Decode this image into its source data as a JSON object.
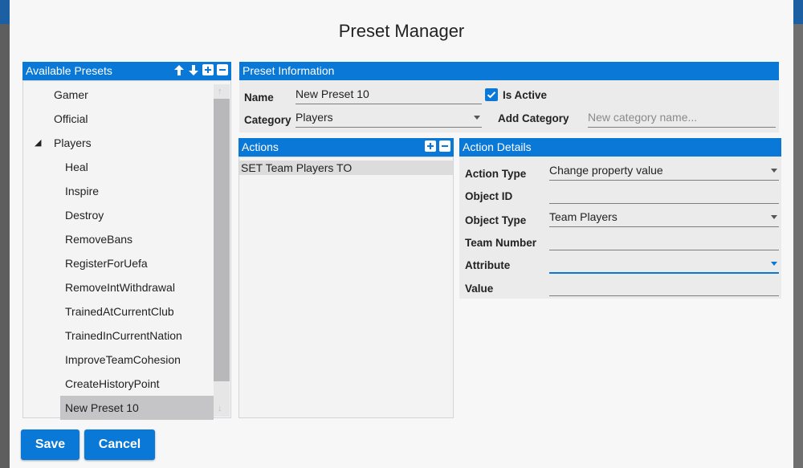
{
  "dialog": {
    "title": "Preset Manager"
  },
  "presets_panel": {
    "title": "Available Presets",
    "items": [
      {
        "label": "Gamer",
        "level": 0
      },
      {
        "label": "Official",
        "level": 0
      },
      {
        "label": "Players",
        "level": 0,
        "expanded": true
      },
      {
        "label": "Heal",
        "level": 1
      },
      {
        "label": "Inspire",
        "level": 1
      },
      {
        "label": "Destroy",
        "level": 1
      },
      {
        "label": "RemoveBans",
        "level": 1
      },
      {
        "label": "RegisterForUefa",
        "level": 1
      },
      {
        "label": "RemoveIntWithdrawal",
        "level": 1
      },
      {
        "label": "TrainedAtCurrentClub",
        "level": 1
      },
      {
        "label": "TrainedInCurrentNation",
        "level": 1
      },
      {
        "label": "ImproveTeamCohesion",
        "level": 1
      },
      {
        "label": "CreateHistoryPoint",
        "level": 1
      },
      {
        "label": "New Preset 10",
        "level": 1,
        "selected": true
      }
    ]
  },
  "preset_info": {
    "title": "Preset Information",
    "name_label": "Name",
    "name_value": "New Preset 10",
    "is_active_label": "Is Active",
    "is_active": true,
    "category_label": "Category",
    "category_value": "Players",
    "add_category_label": "Add Category",
    "add_category_placeholder": "New category name..."
  },
  "actions_panel": {
    "title": "Actions",
    "rows": [
      "SET Team Players  TO"
    ]
  },
  "action_details": {
    "title": "Action Details",
    "action_type_label": "Action Type",
    "action_type_value": "Change property value",
    "object_id_label": "Object ID",
    "object_id_value": "",
    "object_type_label": "Object Type",
    "object_type_value": "Team Players",
    "team_number_label": "Team Number",
    "team_number_value": "",
    "attribute_label": "Attribute",
    "attribute_value": "",
    "value_label": "Value",
    "value_value": ""
  },
  "footer": {
    "save_label": "Save",
    "cancel_label": "Cancel"
  },
  "colors": {
    "accent": "#0a78d6",
    "selected_row": "#c5c5c8",
    "panel_bg": "#ebebeb"
  }
}
